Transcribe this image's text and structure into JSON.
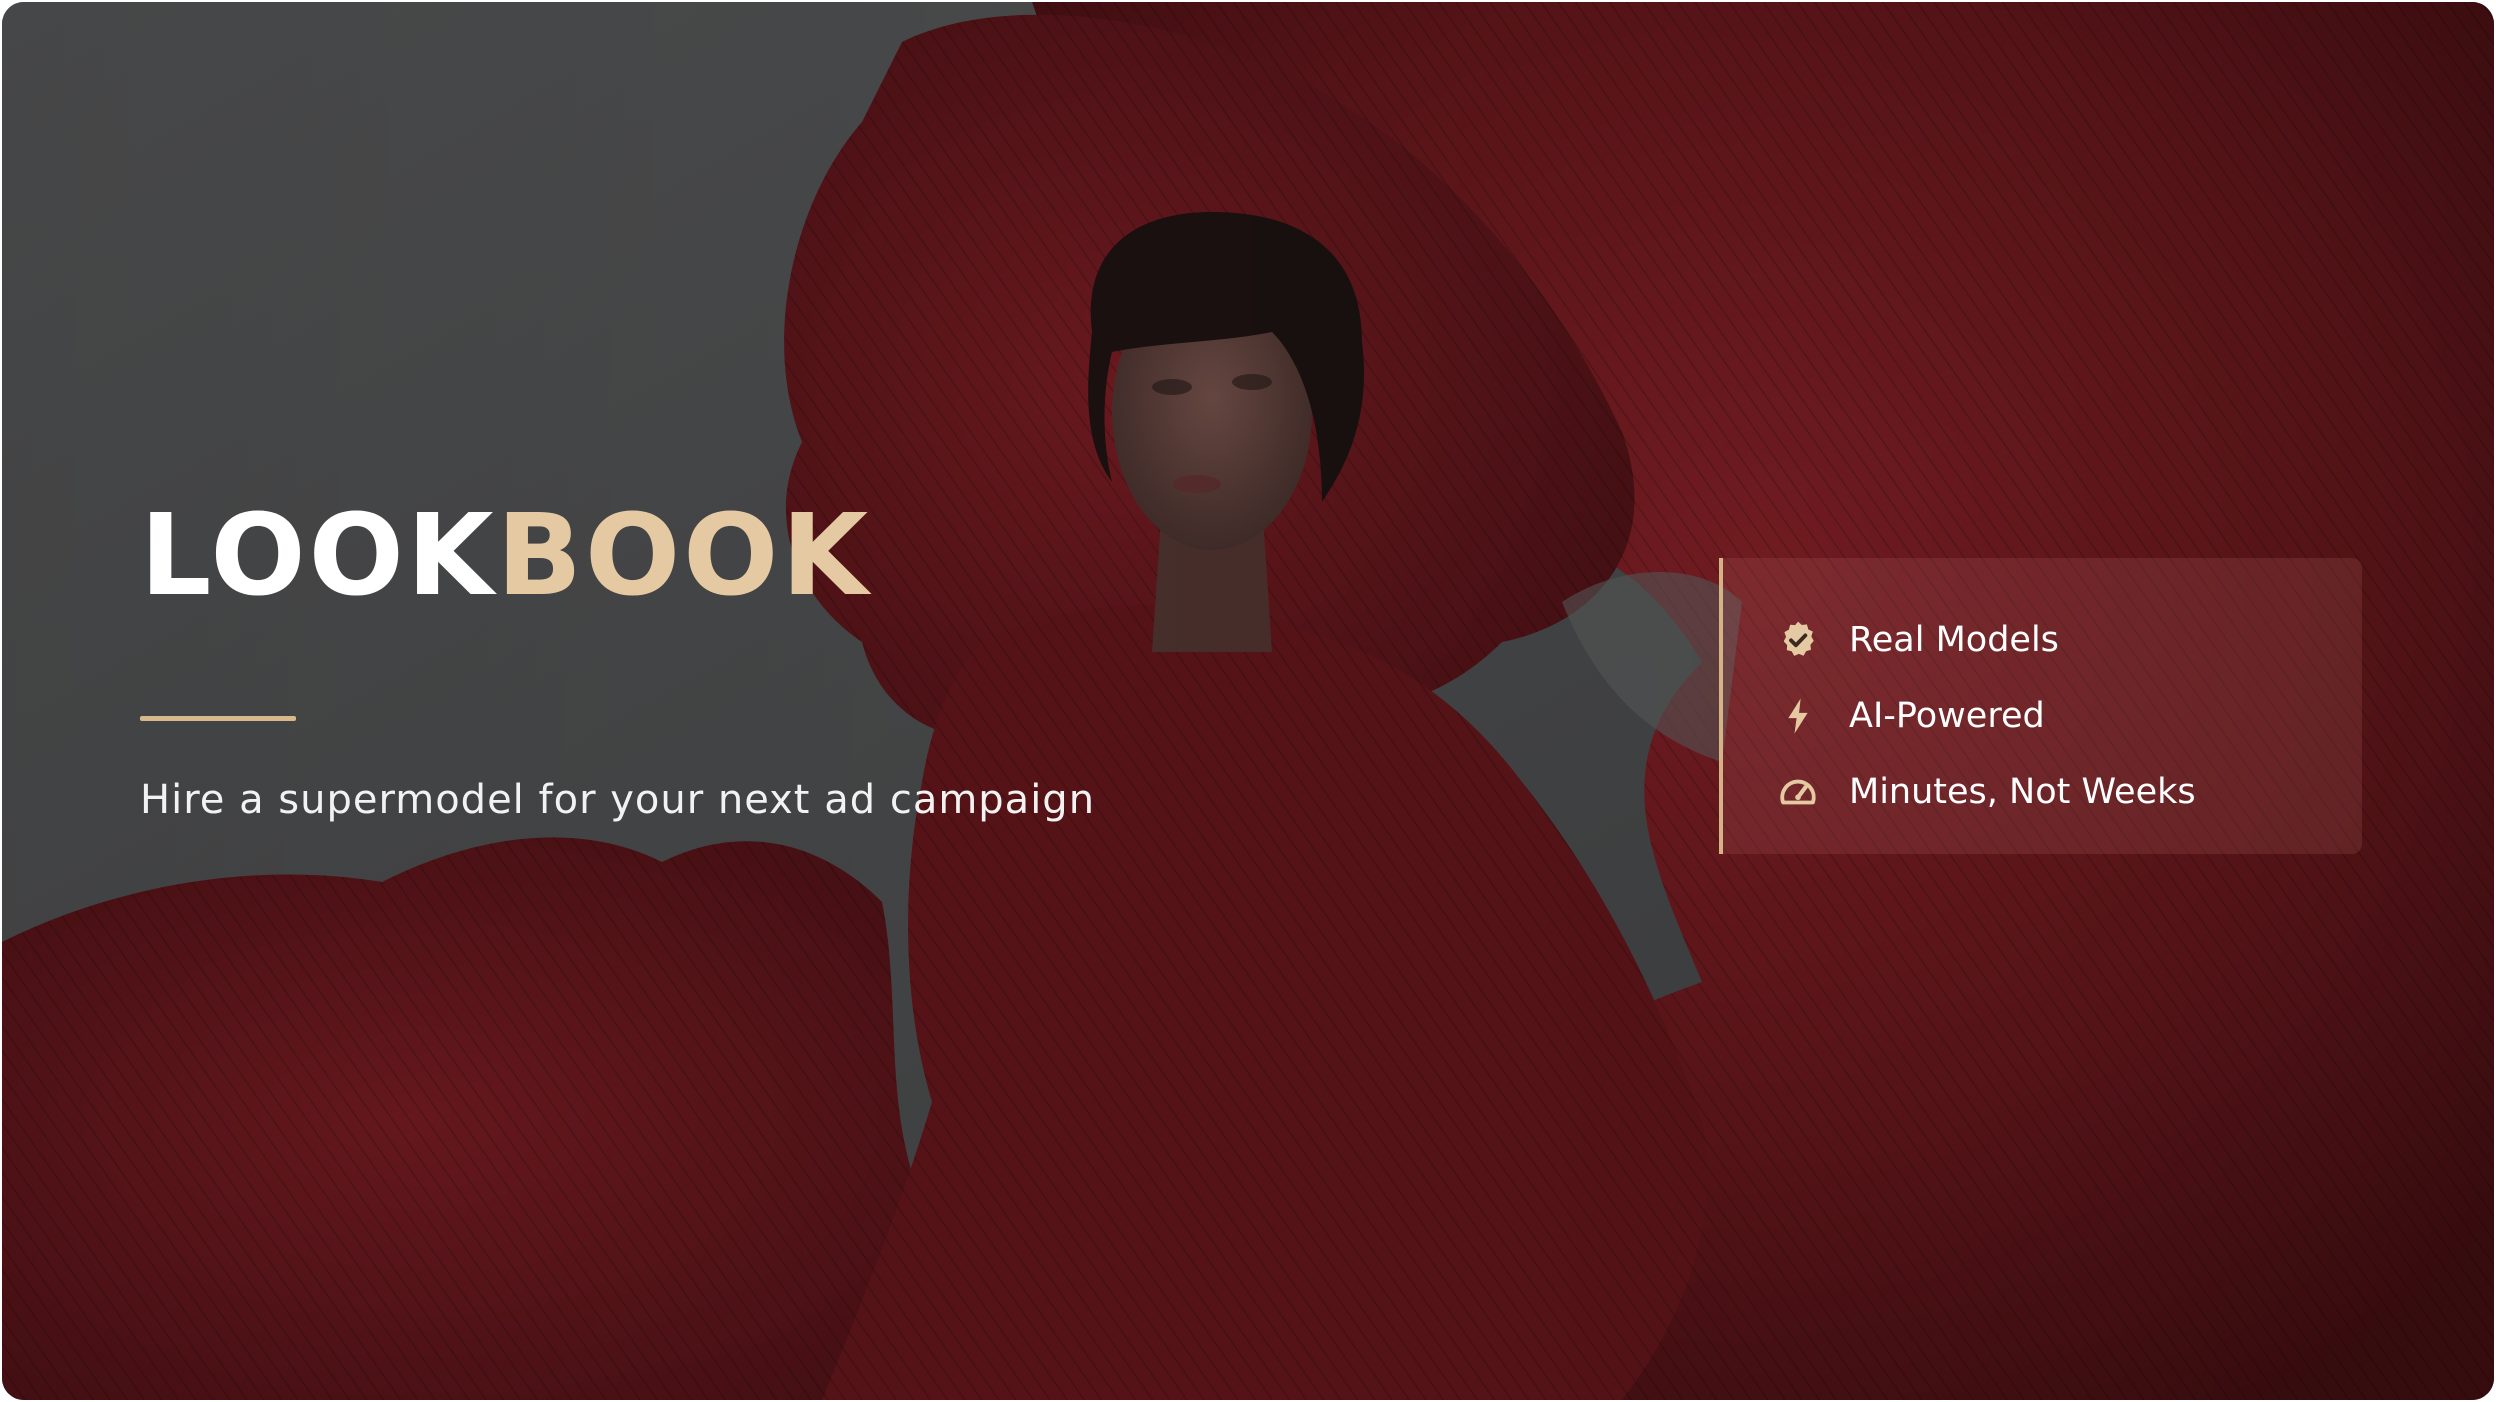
{
  "hero": {
    "title_part_1": "LOOK",
    "title_part_2": "BOOK",
    "tagline": "Hire a supermodel for your next ad campaign"
  },
  "features": [
    {
      "label": "Real Models",
      "icon": "verified-badge-icon"
    },
    {
      "label": "AI-Powered",
      "icon": "lightning-bolt-icon"
    },
    {
      "label": "Minutes, Not Weeks",
      "icon": "speedometer-icon"
    }
  ],
  "colors": {
    "accent": "#e4c9a3",
    "accent_rule": "#d8b88a",
    "backdrop_gray": "#474849",
    "fabric_red": "#5e1519",
    "text_light": "#ffffff"
  }
}
